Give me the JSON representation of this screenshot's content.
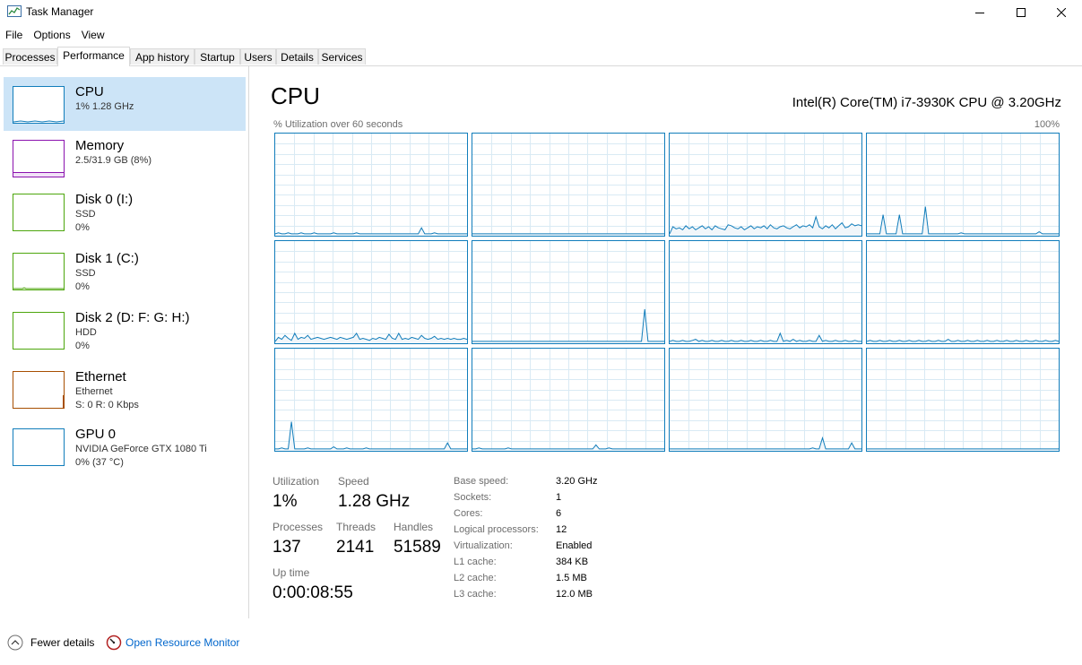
{
  "window": {
    "title": "Task Manager"
  },
  "menu": [
    "File",
    "Options",
    "View"
  ],
  "tabs": [
    "Processes",
    "Performance",
    "App history",
    "Startup",
    "Users",
    "Details",
    "Services"
  ],
  "sidebar": {
    "items": [
      {
        "title": "CPU",
        "line1": "1% 1.28 GHz",
        "line2": ""
      },
      {
        "title": "Memory",
        "line1": "2.5/31.9 GB (8%)",
        "line2": ""
      },
      {
        "title": "Disk 0 (I:)",
        "line1": "SSD",
        "line2": "0%"
      },
      {
        "title": "Disk 1 (C:)",
        "line1": "SSD",
        "line2": "0%"
      },
      {
        "title": "Disk 2 (D: F: G: H:)",
        "line1": "HDD",
        "line2": "0%"
      },
      {
        "title": "Ethernet",
        "line1": "Ethernet",
        "line2": "S: 0 R: 0 Kbps"
      },
      {
        "title": "GPU 0",
        "line1": "NVIDIA GeForce GTX 1080 Ti",
        "line2": "0% (37 °C)"
      }
    ]
  },
  "main": {
    "title": "CPU",
    "cpu_name": "Intel(R) Core(TM) i7-3930K CPU @ 3.20GHz",
    "graph_label": "% Utilization over 60 seconds",
    "graph_max": "100%",
    "stats": {
      "utilization": {
        "label": "Utilization",
        "value": "1%"
      },
      "speed": {
        "label": "Speed",
        "value": "1.28 GHz"
      },
      "processes": {
        "label": "Processes",
        "value": "137"
      },
      "threads": {
        "label": "Threads",
        "value": "2141"
      },
      "handles": {
        "label": "Handles",
        "value": "51589"
      },
      "uptime": {
        "label": "Up time",
        "value": "0:00:08:55"
      }
    },
    "details": [
      {
        "key": "Base speed:",
        "value": "3.20 GHz"
      },
      {
        "key": "Sockets:",
        "value": "1"
      },
      {
        "key": "Cores:",
        "value": "6"
      },
      {
        "key": "Logical processors:",
        "value": "12"
      },
      {
        "key": "Virtualization:",
        "value": "Enabled"
      },
      {
        "key": "L1 cache:",
        "value": "384 KB"
      },
      {
        "key": "L2 cache:",
        "value": "1.5 MB"
      },
      {
        "key": "L3 cache:",
        "value": "12.0 MB"
      }
    ]
  },
  "footer": {
    "fewer_details": "Fewer details",
    "resource_monitor": "Open Resource Monitor"
  },
  "colors": {
    "cpu": "#117dbb",
    "memory": "#8b12ae",
    "disk": "#4da60c",
    "ethernet": "#a74f01",
    "gpu": "#117dbb",
    "selected_bg": "#cce4f7",
    "link": "#0066cc"
  },
  "icons": [
    "task-manager-icon",
    "minimize-icon",
    "maximize-icon",
    "close-icon",
    "chevron-up-icon",
    "resource-monitor-icon"
  ],
  "core_utilization": [
    [
      1,
      2,
      1,
      1,
      2,
      1,
      1,
      1,
      2,
      1,
      1,
      1,
      2,
      1,
      1,
      1,
      1,
      1,
      2,
      1,
      1,
      1,
      1,
      1,
      1,
      2,
      1,
      1,
      1,
      1,
      1,
      1,
      1,
      1,
      1,
      1,
      1,
      1,
      1,
      1,
      1,
      1,
      1,
      1,
      1,
      7,
      1,
      1,
      1,
      2,
      1,
      1,
      1,
      1,
      1,
      1,
      1,
      1,
      1,
      1
    ],
    [
      1,
      1,
      1,
      1,
      1,
      1,
      1,
      1,
      1,
      1,
      1,
      1,
      1,
      1,
      1,
      1,
      1,
      1,
      1,
      1,
      1,
      1,
      1,
      1,
      1,
      1,
      1,
      1,
      1,
      1,
      1,
      1,
      1,
      1,
      1,
      1,
      1,
      1,
      1,
      1,
      1,
      1,
      1,
      1,
      1,
      1,
      1,
      1,
      1,
      1,
      1,
      1,
      1,
      1,
      1,
      1,
      1,
      1,
      1,
      1
    ],
    [
      1,
      8,
      6,
      7,
      5,
      9,
      6,
      8,
      5,
      7,
      9,
      6,
      8,
      5,
      9,
      7,
      6,
      5,
      10,
      9,
      7,
      6,
      8,
      5,
      7,
      9,
      6,
      8,
      7,
      9,
      6,
      10,
      7,
      6,
      8,
      9,
      7,
      6,
      8,
      10,
      7,
      9,
      8,
      10,
      7,
      18,
      8,
      6,
      9,
      7,
      10,
      6,
      9,
      12,
      7,
      8,
      11,
      9,
      10,
      9
    ],
    [
      1,
      1,
      1,
      1,
      1,
      20,
      1,
      1,
      1,
      1,
      20,
      1,
      1,
      1,
      1,
      1,
      1,
      1,
      28,
      1,
      1,
      1,
      1,
      1,
      1,
      1,
      1,
      1,
      1,
      2,
      1,
      1,
      1,
      1,
      1,
      1,
      1,
      1,
      1,
      1,
      1,
      1,
      1,
      1,
      1,
      1,
      1,
      1,
      1,
      1,
      1,
      1,
      1,
      3,
      1,
      1,
      1,
      1,
      1,
      1
    ],
    [
      1,
      5,
      3,
      7,
      4,
      2,
      9,
      3,
      5,
      4,
      7,
      3,
      4,
      5,
      4,
      3,
      4,
      5,
      4,
      3,
      5,
      4,
      3,
      4,
      5,
      9,
      3,
      4,
      3,
      2,
      4,
      3,
      5,
      4,
      3,
      8,
      4,
      3,
      9,
      3,
      4,
      3,
      5,
      4,
      3,
      7,
      4,
      3,
      4,
      6,
      3,
      4,
      3,
      4,
      3,
      4,
      3,
      3,
      4,
      3
    ],
    [
      1,
      1,
      1,
      1,
      1,
      1,
      1,
      1,
      1,
      1,
      1,
      1,
      1,
      1,
      1,
      1,
      1,
      1,
      1,
      1,
      1,
      1,
      1,
      1,
      1,
      1,
      1,
      1,
      1,
      1,
      1,
      1,
      1,
      1,
      1,
      1,
      1,
      1,
      1,
      1,
      1,
      1,
      1,
      1,
      1,
      1,
      1,
      1,
      1,
      1,
      1,
      1,
      1,
      33,
      1,
      1,
      1,
      1,
      1,
      1
    ],
    [
      1,
      2,
      1,
      1,
      2,
      1,
      1,
      2,
      3,
      1,
      2,
      1,
      1,
      2,
      1,
      1,
      2,
      1,
      1,
      2,
      1,
      1,
      2,
      1,
      1,
      2,
      1,
      1,
      2,
      1,
      1,
      2,
      1,
      1,
      9,
      1,
      2,
      1,
      3,
      1,
      2,
      1,
      1,
      2,
      1,
      1,
      7,
      1,
      2,
      1,
      1,
      2,
      1,
      1,
      2,
      1,
      1,
      2,
      1,
      1
    ],
    [
      1,
      2,
      1,
      1,
      2,
      1,
      1,
      2,
      1,
      1,
      2,
      1,
      1,
      2,
      1,
      1,
      2,
      1,
      1,
      2,
      1,
      1,
      2,
      1,
      1,
      3,
      1,
      1,
      2,
      1,
      1,
      2,
      1,
      1,
      2,
      1,
      1,
      2,
      1,
      1,
      2,
      1,
      1,
      2,
      1,
      1,
      2,
      1,
      1,
      2,
      1,
      1,
      2,
      1,
      1,
      2,
      1,
      1,
      2,
      1
    ],
    [
      1,
      1,
      2,
      1,
      1,
      28,
      1,
      1,
      1,
      1,
      2,
      1,
      1,
      1,
      1,
      1,
      1,
      1,
      3,
      1,
      1,
      1,
      2,
      1,
      1,
      1,
      1,
      1,
      2,
      1,
      1,
      1,
      1,
      1,
      1,
      1,
      1,
      1,
      1,
      1,
      1,
      1,
      1,
      1,
      1,
      1,
      1,
      1,
      1,
      1,
      1,
      1,
      1,
      7,
      1,
      1,
      1,
      1,
      1,
      1
    ],
    [
      1,
      1,
      2,
      1,
      1,
      1,
      1,
      1,
      1,
      1,
      1,
      2,
      1,
      1,
      1,
      1,
      1,
      1,
      1,
      1,
      1,
      1,
      1,
      1,
      1,
      1,
      1,
      1,
      1,
      1,
      1,
      1,
      1,
      1,
      1,
      1,
      1,
      1,
      5,
      1,
      1,
      1,
      2,
      1,
      1,
      1,
      1,
      1,
      1,
      1,
      1,
      1,
      1,
      1,
      1,
      1,
      1,
      1,
      1,
      1
    ],
    [
      1,
      1,
      1,
      1,
      1,
      1,
      1,
      1,
      1,
      1,
      1,
      1,
      1,
      1,
      1,
      1,
      1,
      1,
      1,
      1,
      1,
      1,
      1,
      1,
      1,
      1,
      1,
      1,
      1,
      1,
      1,
      1,
      1,
      1,
      1,
      1,
      1,
      1,
      1,
      1,
      1,
      1,
      1,
      1,
      2,
      1,
      1,
      12,
      1,
      1,
      1,
      1,
      1,
      1,
      1,
      1,
      7,
      1,
      1,
      1
    ],
    [
      1,
      1,
      1,
      1,
      1,
      1,
      1,
      1,
      1,
      1,
      1,
      1,
      1,
      1,
      1,
      1,
      1,
      1,
      1,
      1,
      1,
      1,
      1,
      1,
      1,
      1,
      1,
      1,
      1,
      1,
      1,
      1,
      1,
      1,
      1,
      1,
      1,
      1,
      1,
      1,
      1,
      1,
      1,
      1,
      1,
      1,
      1,
      1,
      1,
      1,
      1,
      1,
      1,
      1,
      1,
      1,
      1,
      1,
      1,
      1
    ]
  ]
}
